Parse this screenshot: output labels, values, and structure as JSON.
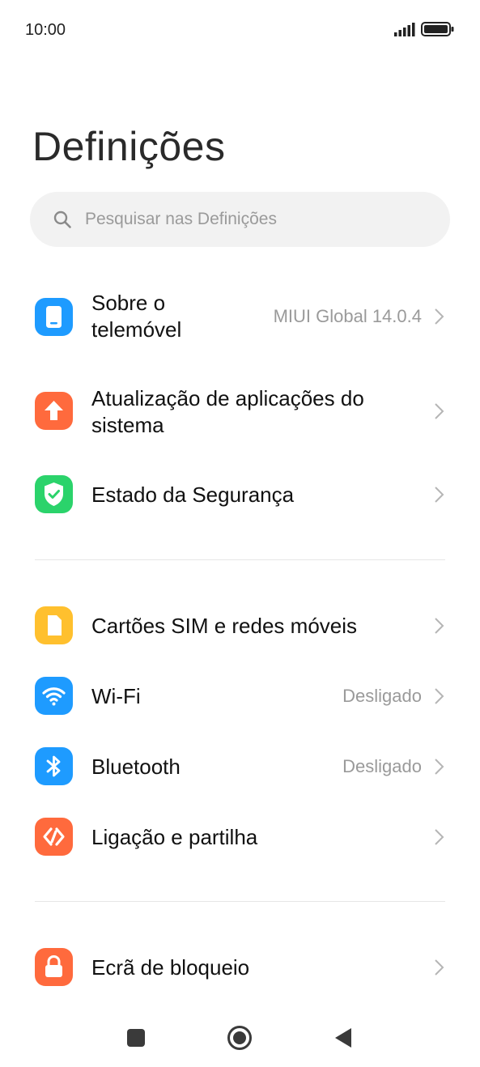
{
  "status_bar": {
    "time": "10:00"
  },
  "page": {
    "title": "Definições"
  },
  "search": {
    "placeholder": "Pesquisar nas Definições",
    "value": ""
  },
  "colors": {
    "about_phone": "#1e9bff",
    "system_updates": "#ff6a3d",
    "security": "#2bd36b",
    "sim_cards": "#ffc02e",
    "wifi": "#1e9bff",
    "bluetooth": "#1e9bff",
    "connection_sharing": "#ff6a3d",
    "lock_screen": "#ff6a3d"
  },
  "items": {
    "about_phone": {
      "label_line1": "Sobre o",
      "label_line2": "telemóvel",
      "value": "MIUI Global 14.0.4",
      "icon": "phone-icon"
    },
    "system_updates": {
      "label_line1": "Atualização de aplicações do",
      "label_line2": "sistema",
      "icon": "arrow-up-icon"
    },
    "security": {
      "label": "Estado da Segurança",
      "icon": "shield-check-icon"
    },
    "sim_cards": {
      "label": "Cartões SIM e redes móveis",
      "icon": "sim-card-icon"
    },
    "wifi": {
      "label": "Wi-Fi",
      "value": "Desligado",
      "icon": "wifi-icon"
    },
    "bluetooth": {
      "label": "Bluetooth",
      "value": "Desligado",
      "icon": "bluetooth-icon"
    },
    "connection_sharing": {
      "label": "Ligação e partilha",
      "icon": "share-connection-icon"
    },
    "lock_screen": {
      "label": "Ecrã de bloqueio",
      "icon": "lock-icon"
    }
  },
  "nav": {
    "recents_icon": "square-icon",
    "home_icon": "circle-icon",
    "back_icon": "triangle-back-icon"
  }
}
